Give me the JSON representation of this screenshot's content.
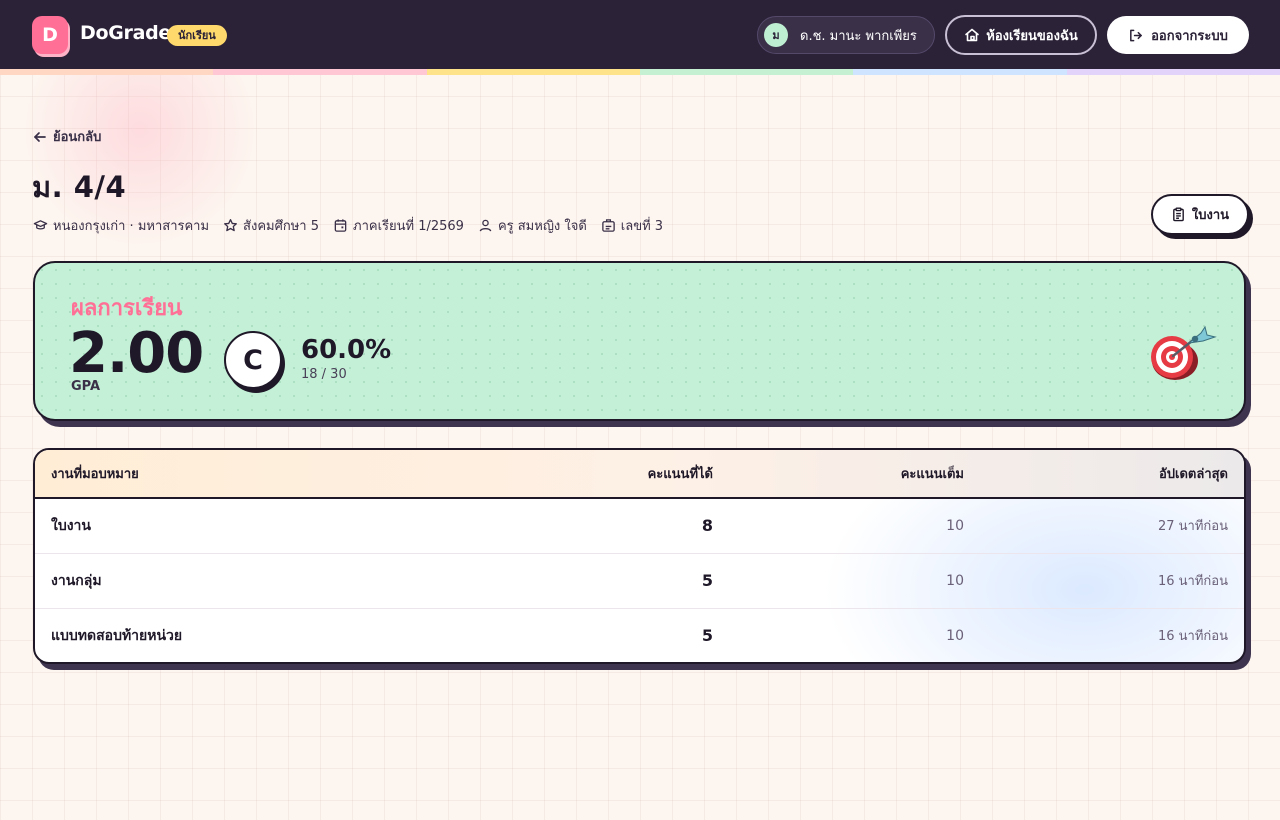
{
  "brand": {
    "logo_letter": "D",
    "name": "DoGrade",
    "role_badge": "นักเรียน"
  },
  "user": {
    "avatar_initial": "ม",
    "name": "ด.ช. มานะ พากเพียร"
  },
  "nav": {
    "my_classes": "ห้องเรียนของฉัน",
    "logout": "ออกจากระบบ"
  },
  "rainbow_colors": [
    "#ffd7c2",
    "#ffc6d3",
    "#ffe38a",
    "#c6f0d2",
    "#cfe4ff",
    "#e2d3fb"
  ],
  "page": {
    "back": "ย้อนกลับ",
    "title": "ม. 4/4",
    "meta": {
      "school": "หนองกรุงเก่า · มหาสารคาม",
      "subject": "สังคมศึกษา 5",
      "term": "ภาคเรียนที่ 1/2569",
      "teacher": "ครู สมหญิง ใจดี",
      "number": "เลขที่ 3"
    },
    "worksheet_button": "ใบงาน"
  },
  "grade": {
    "label": "ผลการเรียน",
    "gpa": "2.00",
    "gpa_caption": "GPA",
    "letter": "C",
    "percent": "60.0%",
    "score_fraction": "18 / 30",
    "accent_color": "#ff6f96",
    "card_color": "#c3f0d6"
  },
  "table": {
    "headers": {
      "assignment": "งานที่มอบหมาย",
      "score": "คะแนนที่ได้",
      "max": "คะแนนเต็ม",
      "updated": "อัปเดตล่าสุด"
    },
    "rows": [
      {
        "name": "ใบงาน",
        "score": "8",
        "max": "10",
        "updated": "27 นาทีก่อน"
      },
      {
        "name": "งานกลุ่ม",
        "score": "5",
        "max": "10",
        "updated": "16 นาทีก่อน"
      },
      {
        "name": "แบบทดสอบท้ายหน่วย",
        "score": "5",
        "max": "10",
        "updated": "16 นาทีก่อน"
      }
    ]
  }
}
